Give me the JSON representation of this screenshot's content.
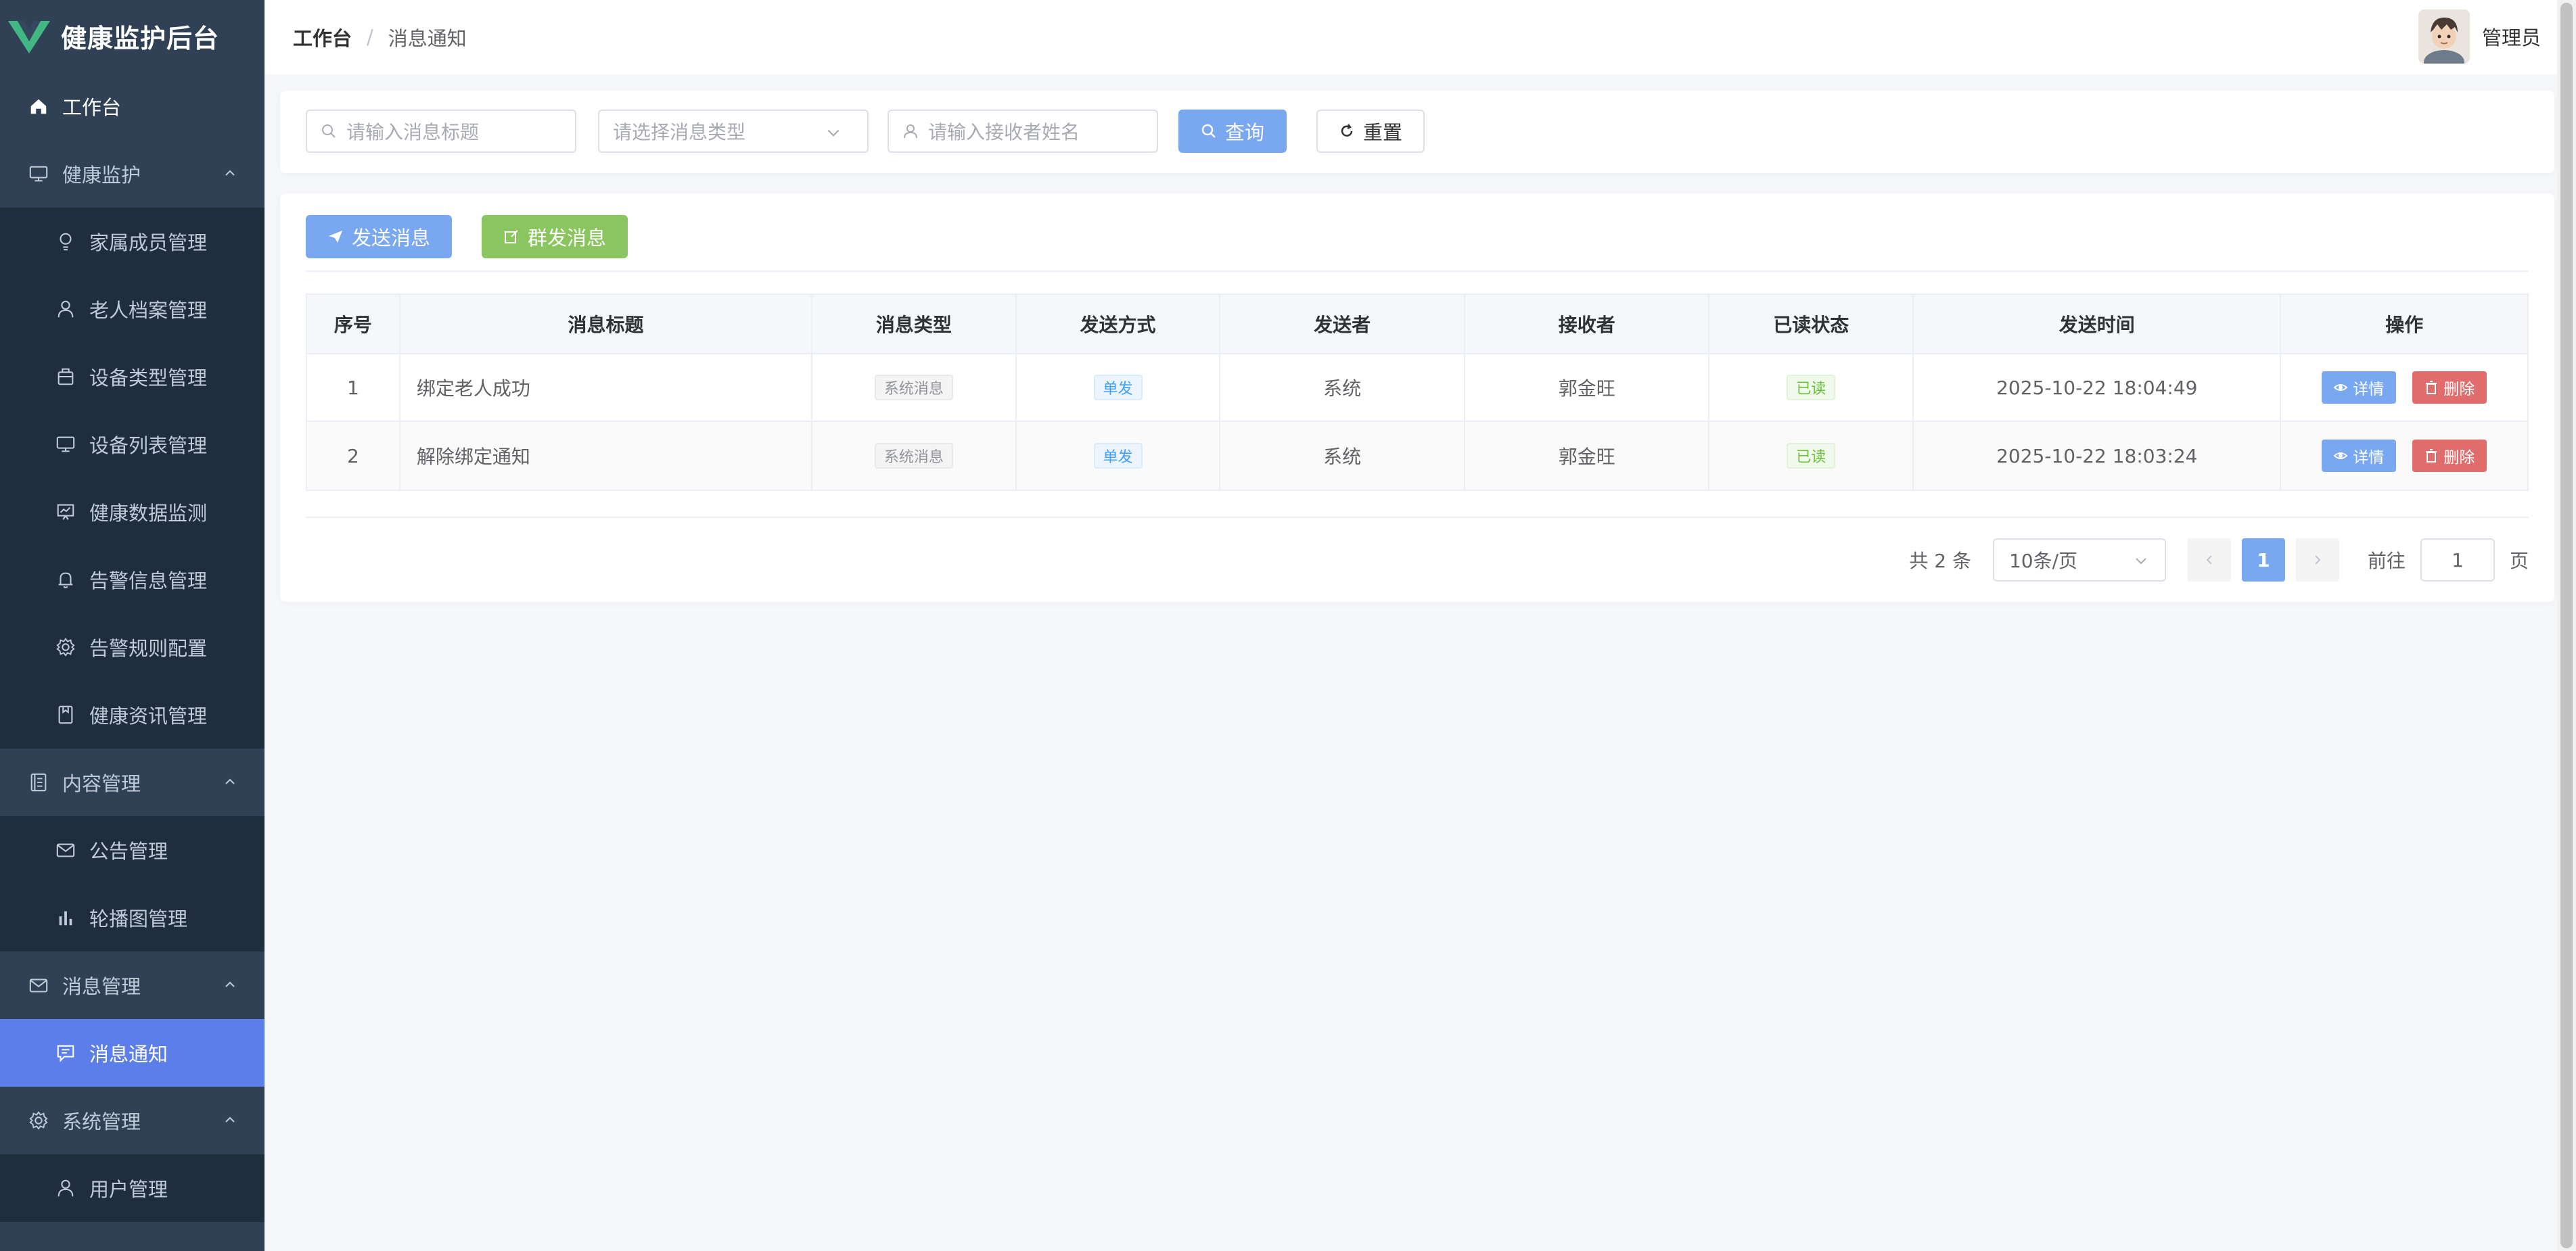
{
  "app": {
    "title": "健康监护后台"
  },
  "colors": {
    "sidebar_bg": "#304156",
    "active": "#5c7ee8",
    "primary": "#79a7f0",
    "success": "#8bc55f",
    "danger": "#e06c6c"
  },
  "sidebar": {
    "items": [
      {
        "label": "工作台",
        "icon": "home-icon",
        "level": "top"
      },
      {
        "label": "健康监护",
        "icon": "monitor-icon",
        "level": "group"
      },
      {
        "label": "家属成员管理",
        "icon": "lightbulb-icon",
        "level": "sub"
      },
      {
        "label": "老人档案管理",
        "icon": "user-icon",
        "level": "sub"
      },
      {
        "label": "设备类型管理",
        "icon": "box-icon",
        "level": "sub"
      },
      {
        "label": "设备列表管理",
        "icon": "monitor-icon",
        "level": "sub"
      },
      {
        "label": "健康数据监测",
        "icon": "chart-board-icon",
        "level": "sub"
      },
      {
        "label": "告警信息管理",
        "icon": "bell-icon",
        "level": "sub"
      },
      {
        "label": "告警规则配置",
        "icon": "gear-icon",
        "level": "sub"
      },
      {
        "label": "健康资讯管理",
        "icon": "notebook-icon",
        "level": "sub"
      },
      {
        "label": "内容管理",
        "icon": "document-icon",
        "level": "group"
      },
      {
        "label": "公告管理",
        "icon": "mail-icon",
        "level": "sub"
      },
      {
        "label": "轮播图管理",
        "icon": "bar-chart-icon",
        "level": "sub"
      },
      {
        "label": "消息管理",
        "icon": "mail-icon",
        "level": "group"
      },
      {
        "label": "消息通知",
        "icon": "message-icon",
        "level": "sub-active"
      },
      {
        "label": "系统管理",
        "icon": "gear-icon",
        "level": "group"
      },
      {
        "label": "用户管理",
        "icon": "user-icon",
        "level": "sub"
      }
    ]
  },
  "header": {
    "breadcrumb_home": "工作台",
    "breadcrumb_sep": "/",
    "breadcrumb_current": "消息通知",
    "user_name": "管理员"
  },
  "search": {
    "title_placeholder": "请输入消息标题",
    "type_placeholder": "请选择消息类型",
    "receiver_placeholder": "请输入接收者姓名",
    "query_label": "查询",
    "reset_label": "重置"
  },
  "toolbar": {
    "send_label": "发送消息",
    "broadcast_label": "群发消息"
  },
  "table": {
    "columns": [
      "序号",
      "消息标题",
      "消息类型",
      "发送方式",
      "发送者",
      "接收者",
      "已读状态",
      "发送时间",
      "操作"
    ],
    "rows": [
      {
        "index": "1",
        "title": "绑定老人成功",
        "type": "系统消息",
        "method": "单发",
        "sender": "系统",
        "receiver": "郭金旺",
        "read": "已读",
        "time": "2025-10-22 18:04:49",
        "detail": "详情",
        "delete": "删除"
      },
      {
        "index": "2",
        "title": "解除绑定通知",
        "type": "系统消息",
        "method": "单发",
        "sender": "系统",
        "receiver": "郭金旺",
        "read": "已读",
        "time": "2025-10-22 18:03:24",
        "detail": "详情",
        "delete": "删除"
      }
    ]
  },
  "pagination": {
    "total_text": "共 2 条",
    "page_size": "10条/页",
    "current_page": "1",
    "goto_label": "前往",
    "goto_value": "1",
    "page_suffix": "页"
  }
}
